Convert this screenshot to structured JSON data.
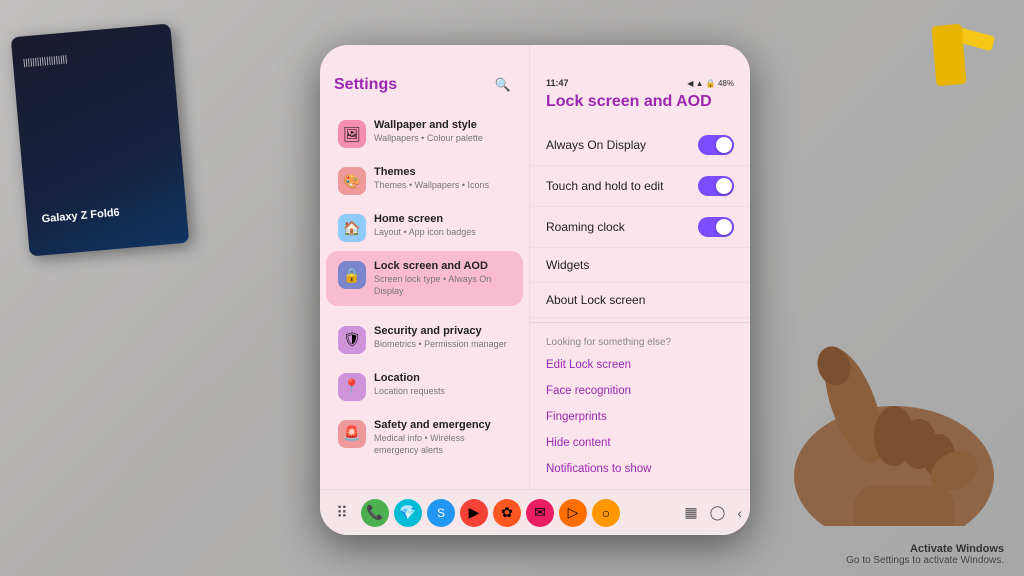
{
  "device": {
    "status_bar": {
      "time": "11:47",
      "icons": "◀ ▲ 🔒 48%"
    }
  },
  "settings": {
    "title": "Settings",
    "search_icon": "🔍",
    "items": [
      {
        "id": "wallpaper",
        "icon": "🖼",
        "icon_bg": "#e91e63",
        "title": "Wallpaper and style",
        "subtitle": "Wallpapers • Colour palette"
      },
      {
        "id": "themes",
        "icon": "🎨",
        "icon_bg": "#f44336",
        "title": "Themes",
        "subtitle": "Themes • Wallpapers • Icons"
      },
      {
        "id": "home-screen",
        "icon": "🏠",
        "icon_bg": "#2196f3",
        "title": "Home screen",
        "subtitle": "Layout • App icon badges"
      },
      {
        "id": "lock-screen",
        "icon": "🔒",
        "icon_bg": "#3f51b5",
        "title": "Lock screen and AOD",
        "subtitle": "Screen lock type • Always On Display",
        "active": true
      },
      {
        "id": "security",
        "icon": "🛡",
        "icon_bg": "#673ab7",
        "title": "Security and privacy",
        "subtitle": "Biometrics • Permission manager"
      },
      {
        "id": "location",
        "icon": "📍",
        "icon_bg": "#673ab7",
        "title": "Location",
        "subtitle": "Location requests"
      },
      {
        "id": "safety",
        "icon": "🚨",
        "icon_bg": "#f44336",
        "title": "Safety and emergency",
        "subtitle": "Medical info • Wireless emergency alerts"
      }
    ]
  },
  "lock_screen": {
    "title": "Lock screen and AOD",
    "settings": [
      {
        "id": "always-on-display",
        "label": "Always On Display",
        "toggle": true,
        "toggle_state": "on"
      },
      {
        "id": "touch-hold-edit",
        "label": "Touch and hold to edit",
        "toggle": true,
        "toggle_state": "on"
      },
      {
        "id": "roaming-clock",
        "label": "Roaming clock",
        "toggle": true,
        "toggle_state": "on"
      },
      {
        "id": "widgets",
        "label": "Widgets",
        "toggle": false
      },
      {
        "id": "about-lock",
        "label": "About Lock screen",
        "toggle": false
      }
    ],
    "looking_for_label": "Looking for something else?",
    "links": [
      "Edit Lock screen",
      "Face recognition",
      "Fingerprints",
      "Hide content",
      "Notifications to show"
    ]
  },
  "nav_bar": {
    "apps": [
      {
        "icon": "⠿",
        "color": "#555",
        "label": "all-apps"
      },
      {
        "icon": "📞",
        "color": "#4caf50",
        "label": "phone"
      },
      {
        "icon": "💎",
        "color": "#00bcd4",
        "label": "gem"
      },
      {
        "icon": "💬",
        "color": "#2196f3",
        "label": "skype"
      },
      {
        "icon": "▶",
        "color": "#f44336",
        "label": "youtube"
      },
      {
        "icon": "✿",
        "color": "#ff5722",
        "label": "flower"
      },
      {
        "icon": "✉",
        "color": "#e91e63",
        "label": "mail"
      },
      {
        "icon": "▷",
        "color": "#ff6f00",
        "label": "play"
      },
      {
        "icon": "○",
        "color": "#ff9800",
        "label": "circle"
      }
    ],
    "controls": [
      "▦",
      "◯",
      "‹"
    ]
  },
  "windows": {
    "activate_title": "Activate Windows",
    "activate_sub": "Go to Settings to activate Windows."
  }
}
